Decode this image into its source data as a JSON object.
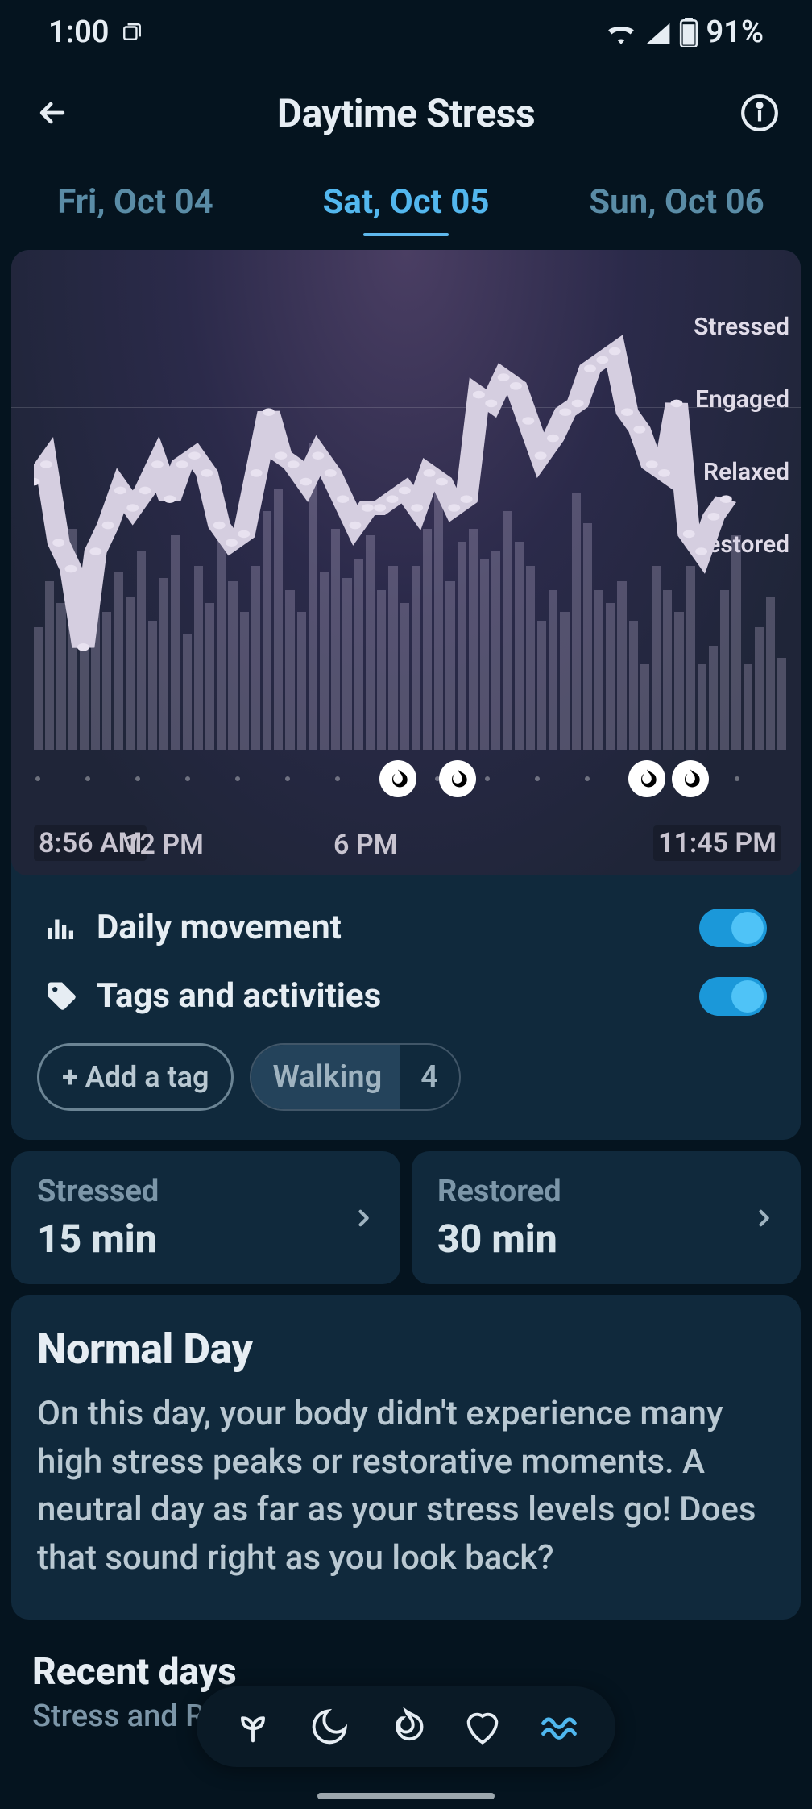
{
  "statusbar": {
    "time": "1:00",
    "battery": "91%"
  },
  "header": {
    "title": "Daytime Stress"
  },
  "date_tabs": {
    "prev": "Fri, Oct 04",
    "selected": "Sat, Oct 05",
    "next": "Sun, Oct 06"
  },
  "chart_data": {
    "type": "line",
    "y_labels": [
      "Stressed",
      "Engaged",
      "Relaxed",
      "Restored"
    ],
    "x_labels": {
      "start": "8:56 AM",
      "noon": "12 PM",
      "six": "6 PM",
      "end": "11:45 PM"
    },
    "series": [
      {
        "name": "stress_level",
        "x": [
          0,
          1,
          2,
          3,
          4,
          5,
          6,
          7,
          8,
          9,
          10,
          11,
          12,
          13,
          14,
          15,
          16,
          17,
          18,
          19,
          20,
          21,
          22,
          23,
          24,
          25,
          26,
          27,
          28,
          29,
          30,
          31,
          32,
          33,
          34,
          35,
          36,
          37,
          38,
          39,
          40,
          41,
          42,
          43,
          44,
          45,
          46,
          47,
          48,
          49,
          50,
          51,
          52,
          53,
          54,
          55,
          56
        ],
        "values": [
          56,
          60,
          42,
          36,
          18,
          40,
          46,
          54,
          50,
          54,
          60,
          52,
          60,
          62,
          58,
          46,
          42,
          44,
          58,
          72,
          62,
          60,
          56,
          62,
          58,
          52,
          46,
          50,
          50,
          52,
          54,
          50,
          58,
          56,
          50,
          52,
          76,
          74,
          80,
          78,
          70,
          62,
          66,
          72,
          74,
          82,
          84,
          86,
          72,
          68,
          60,
          58,
          74,
          44,
          40,
          48,
          52
        ]
      }
    ],
    "bars_series": {
      "name": "daily_movement",
      "values": [
        40,
        55,
        48,
        72,
        35,
        60,
        45,
        58,
        50,
        65,
        42,
        56,
        70,
        38,
        60,
        48,
        72,
        55,
        45,
        60,
        78,
        85,
        52,
        45,
        100,
        58,
        72,
        56,
        62,
        70,
        52,
        60,
        48,
        60,
        72,
        85,
        55,
        68,
        72,
        62,
        65,
        78,
        68,
        60,
        42,
        52,
        45,
        84,
        74,
        52,
        48,
        55,
        42,
        28,
        60,
        52,
        45,
        60,
        28,
        34,
        52,
        70,
        28,
        40,
        50,
        30
      ]
    },
    "activity_markers_pct": [
      49,
      56.5,
      80.5,
      86
    ]
  },
  "toggles": {
    "movement_label": "Daily movement",
    "movement_on": true,
    "tags_label": "Tags and activities",
    "tags_on": true,
    "add_tag_label": "+ Add a tag",
    "chips": [
      {
        "name": "Walking",
        "count": "4"
      }
    ]
  },
  "stats": {
    "stressed": {
      "label": "Stressed",
      "value": "15 min"
    },
    "restored": {
      "label": "Restored",
      "value": "30 min"
    }
  },
  "summary": {
    "title": "Normal Day",
    "body": "On this day, your body didn't experience many high stress peaks or restorative moments. A neutral day as far as your stress levels go! Does that sound right as you look back?"
  },
  "recent": {
    "title": "Recent days",
    "subtitle": "Stress and Restorative Time"
  }
}
